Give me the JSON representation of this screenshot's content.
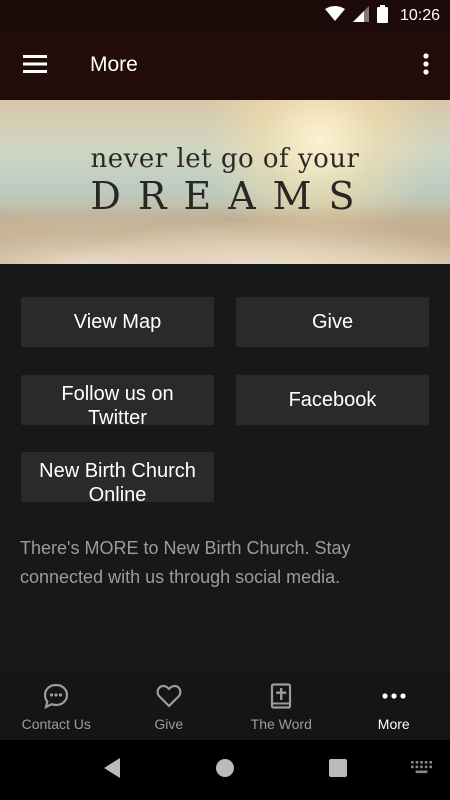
{
  "status_bar": {
    "time": "10:26"
  },
  "app_bar": {
    "title": "More"
  },
  "banner": {
    "line1": "never let go of your",
    "line2": "DREAMS"
  },
  "buttons": [
    {
      "lines": [
        "View Map"
      ]
    },
    {
      "lines": [
        "Give"
      ]
    },
    {
      "lines": [
        "Follow us on",
        "Twitter"
      ]
    },
    {
      "lines": [
        "Facebook"
      ]
    },
    {
      "lines": [
        "New Birth Church",
        "Online"
      ]
    }
  ],
  "info_text": "There's MORE to New Birth Church. Stay connected with us through social media.",
  "bottom_nav": {
    "items": [
      {
        "label": "Contact Us",
        "icon": "chat-icon"
      },
      {
        "label": "Give",
        "icon": "heart-icon"
      },
      {
        "label": "The Word",
        "icon": "bible-icon"
      },
      {
        "label": "More",
        "icon": "more-dots-icon",
        "active": true
      }
    ]
  },
  "colors": {
    "app_bar": "#220c09",
    "background": "#17181a",
    "button": "#2a2a2c",
    "muted_text": "#9c9c9c"
  }
}
